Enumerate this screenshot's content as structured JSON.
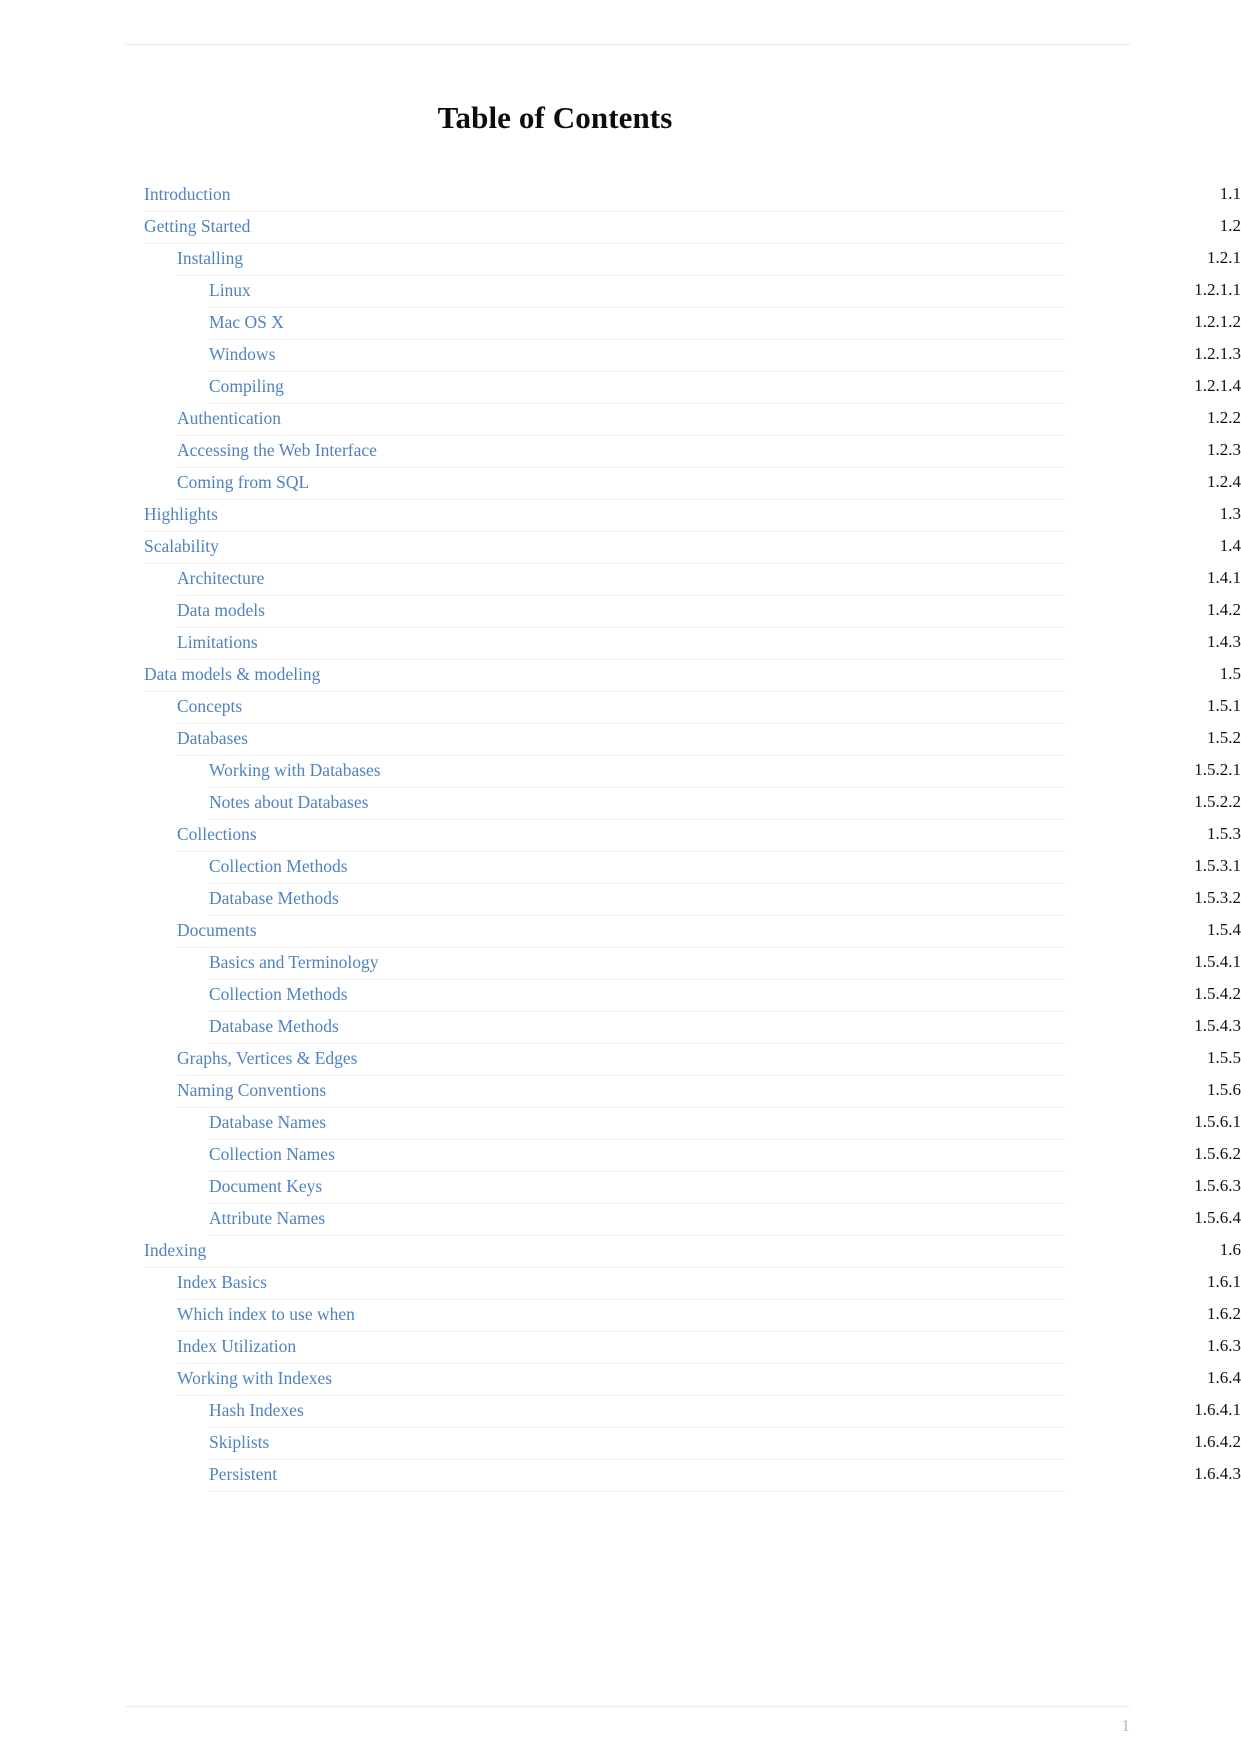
{
  "document": {
    "title": "Table of Contents",
    "page_number": "1"
  },
  "toc": {
    "entries": [
      {
        "label": "Introduction",
        "number": "1.1",
        "level": 0
      },
      {
        "label": "Getting Started",
        "number": "1.2",
        "level": 0
      },
      {
        "label": "Installing",
        "number": "1.2.1",
        "level": 1
      },
      {
        "label": "Linux",
        "number": "1.2.1.1",
        "level": 2
      },
      {
        "label": "Mac OS X",
        "number": "1.2.1.2",
        "level": 2
      },
      {
        "label": "Windows",
        "number": "1.2.1.3",
        "level": 2
      },
      {
        "label": "Compiling",
        "number": "1.2.1.4",
        "level": 2
      },
      {
        "label": "Authentication",
        "number": "1.2.2",
        "level": 1
      },
      {
        "label": "Accessing the Web Interface",
        "number": "1.2.3",
        "level": 1
      },
      {
        "label": "Coming from SQL",
        "number": "1.2.4",
        "level": 1
      },
      {
        "label": "Highlights",
        "number": "1.3",
        "level": 0
      },
      {
        "label": "Scalability",
        "number": "1.4",
        "level": 0
      },
      {
        "label": "Architecture",
        "number": "1.4.1",
        "level": 1
      },
      {
        "label": "Data models",
        "number": "1.4.2",
        "level": 1
      },
      {
        "label": "Limitations",
        "number": "1.4.3",
        "level": 1
      },
      {
        "label": "Data models & modeling",
        "number": "1.5",
        "level": 0
      },
      {
        "label": "Concepts",
        "number": "1.5.1",
        "level": 1
      },
      {
        "label": "Databases",
        "number": "1.5.2",
        "level": 1
      },
      {
        "label": "Working with Databases",
        "number": "1.5.2.1",
        "level": 2
      },
      {
        "label": "Notes about Databases",
        "number": "1.5.2.2",
        "level": 2
      },
      {
        "label": "Collections",
        "number": "1.5.3",
        "level": 1
      },
      {
        "label": "Collection Methods",
        "number": "1.5.3.1",
        "level": 2
      },
      {
        "label": "Database Methods",
        "number": "1.5.3.2",
        "level": 2
      },
      {
        "label": "Documents",
        "number": "1.5.4",
        "level": 1
      },
      {
        "label": "Basics and Terminology",
        "number": "1.5.4.1",
        "level": 2
      },
      {
        "label": "Collection Methods",
        "number": "1.5.4.2",
        "level": 2
      },
      {
        "label": "Database Methods",
        "number": "1.5.4.3",
        "level": 2
      },
      {
        "label": "Graphs, Vertices & Edges",
        "number": "1.5.5",
        "level": 1
      },
      {
        "label": "Naming Conventions",
        "number": "1.5.6",
        "level": 1
      },
      {
        "label": "Database Names",
        "number": "1.5.6.1",
        "level": 2
      },
      {
        "label": "Collection Names",
        "number": "1.5.6.2",
        "level": 2
      },
      {
        "label": "Document Keys",
        "number": "1.5.6.3",
        "level": 2
      },
      {
        "label": "Attribute Names",
        "number": "1.5.6.4",
        "level": 2
      },
      {
        "label": "Indexing",
        "number": "1.6",
        "level": 0
      },
      {
        "label": "Index Basics",
        "number": "1.6.1",
        "level": 1
      },
      {
        "label": "Which index to use when",
        "number": "1.6.2",
        "level": 1
      },
      {
        "label": "Index Utilization",
        "number": "1.6.3",
        "level": 1
      },
      {
        "label": "Working with Indexes",
        "number": "1.6.4",
        "level": 1
      },
      {
        "label": "Hash Indexes",
        "number": "1.6.4.1",
        "level": 2
      },
      {
        "label": "Skiplists",
        "number": "1.6.4.2",
        "level": 2
      },
      {
        "label": "Persistent",
        "number": "1.6.4.3",
        "level": 2
      }
    ]
  },
  "colors": {
    "link": "#4f83c0",
    "number": "#111111",
    "rule": "#eeeeee",
    "page_number": "#b9b9b9"
  }
}
